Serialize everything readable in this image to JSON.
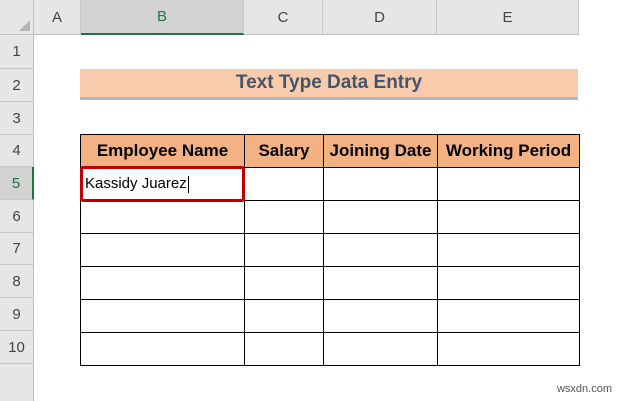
{
  "columns": [
    "A",
    "B",
    "C",
    "D",
    "E"
  ],
  "rows": [
    "1",
    "2",
    "3",
    "4",
    "5",
    "6",
    "7",
    "8",
    "9",
    "10"
  ],
  "title": "Text Type Data Entry",
  "table": {
    "headers": [
      "Employee Name",
      "Salary",
      "Joining Date",
      "Working Period"
    ],
    "first_entry": "Kassidy Juarez"
  },
  "watermark": "wsxdn.com"
}
